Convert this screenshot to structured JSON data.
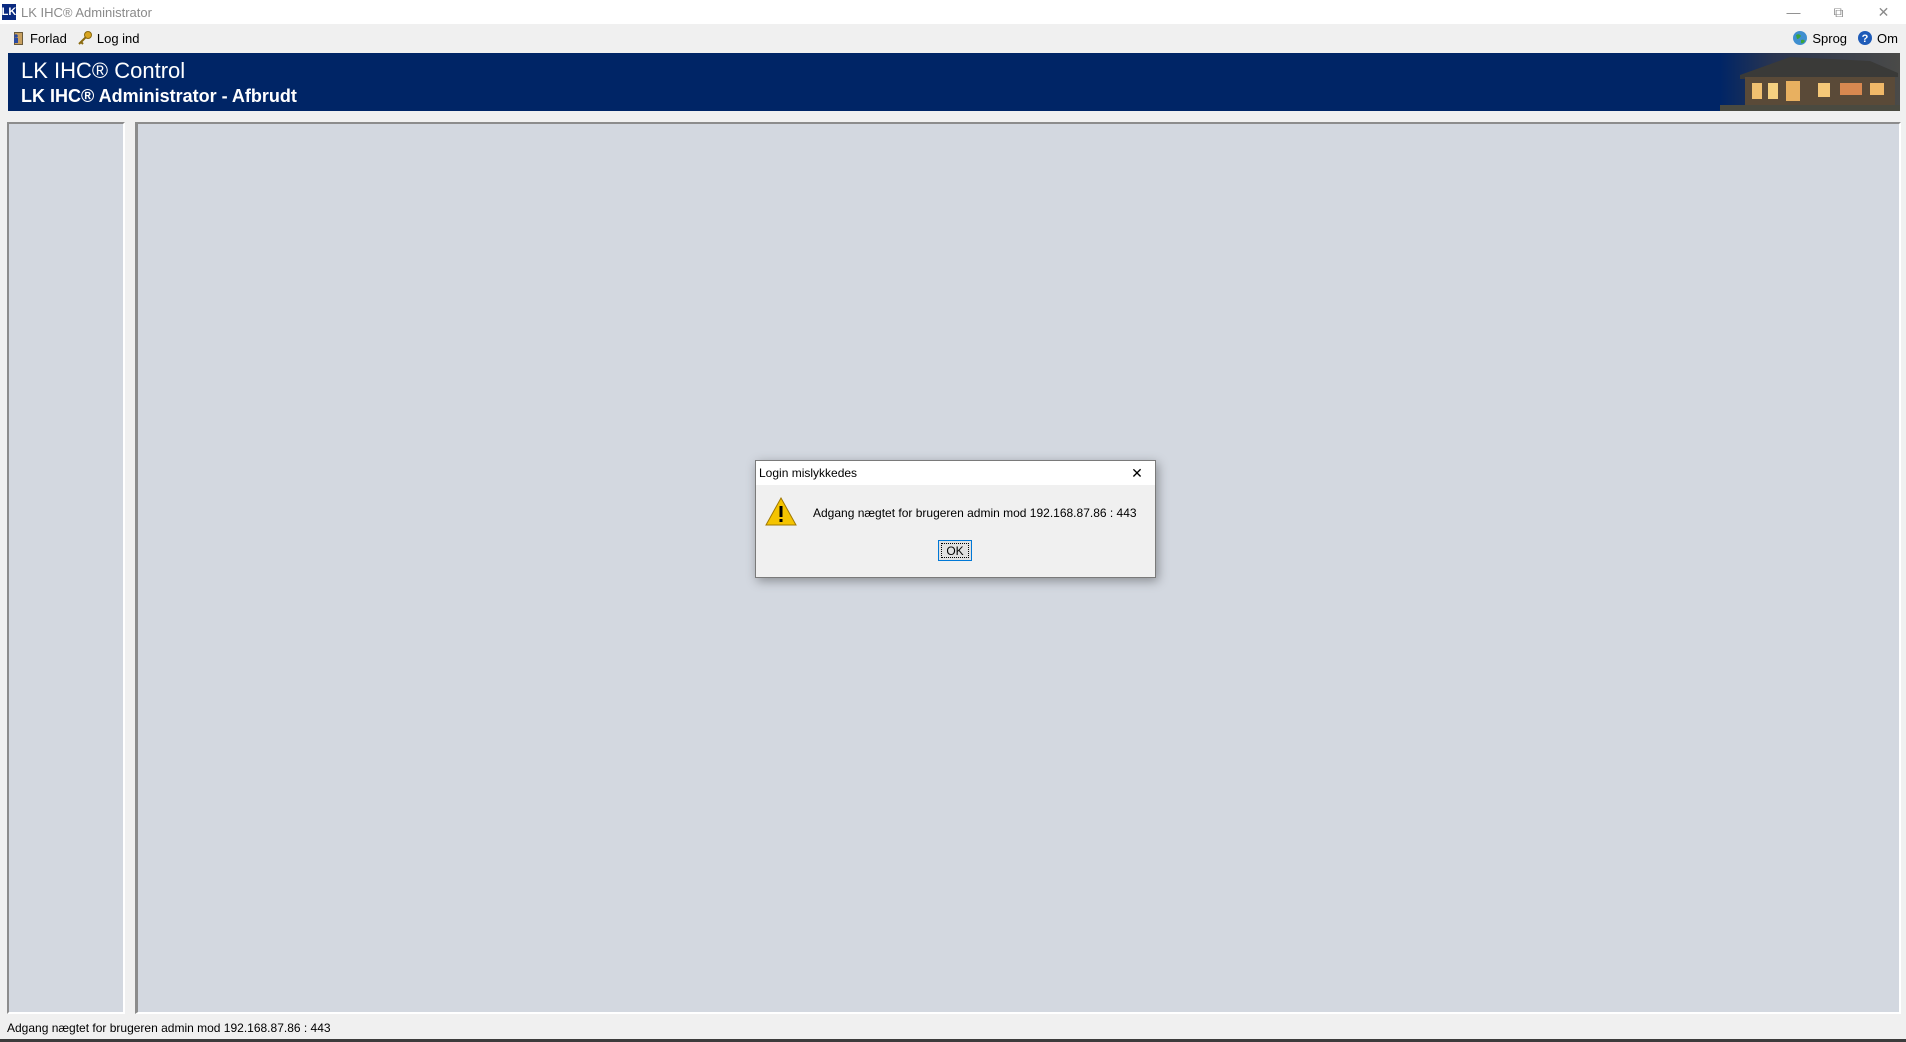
{
  "window": {
    "title": "LK IHC® Administrator",
    "logo_text": "LK",
    "controls": [
      "—",
      "⧉",
      "✕"
    ]
  },
  "toolbar": {
    "exit_label": "Forlad",
    "login_label": "Log ind",
    "language_label": "Sprog",
    "about_label": "Om"
  },
  "banner": {
    "title": "LK IHC® Control",
    "subtitle": "LK IHC® Administrator - Afbrudt"
  },
  "dialog": {
    "title": "Login mislykkedes",
    "message": "Adgang nægtet for brugeren admin mod 192.168.87.86 : 443",
    "ok_label": "OK",
    "close_glyph": "✕"
  },
  "statusbar": {
    "text": "Adgang nægtet for brugeren admin mod 192.168.87.86 : 443"
  },
  "colors": {
    "banner_bg": "#002566",
    "panel_bg": "#d3d8e0",
    "accent": "#0078d7"
  },
  "icons": {
    "exit": "door-exit-icon",
    "login": "key-icon",
    "language": "globe-icon",
    "about": "help-icon",
    "warning": "warning-icon"
  }
}
